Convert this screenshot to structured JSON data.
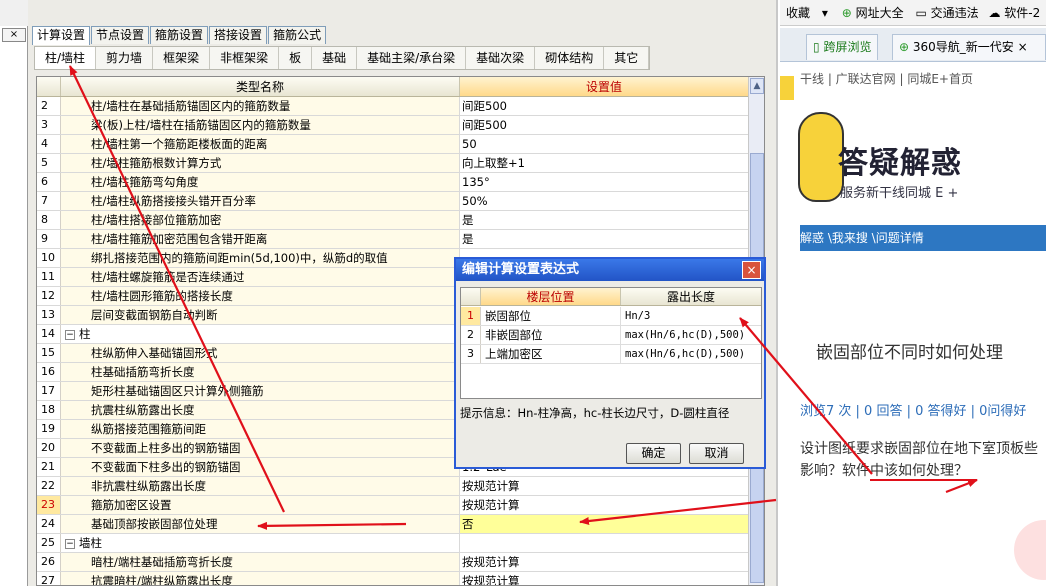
{
  "left_strip": {
    "close_glyph": "×"
  },
  "top_tabs": [
    {
      "label": "计算设置",
      "active": true
    },
    {
      "label": "节点设置"
    },
    {
      "label": "箍筋设置"
    },
    {
      "label": "搭接设置"
    },
    {
      "label": "箍筋公式"
    }
  ],
  "sub_tabs": [
    {
      "label": "柱/墙柱",
      "active": true
    },
    {
      "label": "剪力墙"
    },
    {
      "label": "框架梁"
    },
    {
      "label": "非框架梁"
    },
    {
      "label": "板"
    },
    {
      "label": "基础"
    },
    {
      "label": "基础主梁/承台梁"
    },
    {
      "label": "基础次梁"
    },
    {
      "label": "砌体结构"
    },
    {
      "label": "其它"
    }
  ],
  "grid": {
    "header_name": "类型名称",
    "header_value": "设置值",
    "rows": [
      {
        "n": "2",
        "name": "柱/墙柱在基础插筋锚固区内的箍筋数量",
        "val": "间距500"
      },
      {
        "n": "3",
        "name": "梁(板)上柱/墙柱在插筋锚固区内的箍筋数量",
        "val": "间距500"
      },
      {
        "n": "4",
        "name": "柱/墙柱第一个箍筋距楼板面的距离",
        "val": "50"
      },
      {
        "n": "5",
        "name": "柱/墙柱箍筋根数计算方式",
        "val": "向上取整+1"
      },
      {
        "n": "6",
        "name": "柱/墙柱箍筋弯勾角度",
        "val": "135°"
      },
      {
        "n": "7",
        "name": "柱/墙柱纵筋搭接接头错开百分率",
        "val": "50%"
      },
      {
        "n": "8",
        "name": "柱/墙柱搭接部位箍筋加密",
        "val": "是"
      },
      {
        "n": "9",
        "name": "柱/墙柱箍筋加密范围包含错开距离",
        "val": "是"
      },
      {
        "n": "10",
        "name": "绑扎搭接范围内的箍筋间距min(5d,100)中，纵筋d的取值",
        "val": ""
      },
      {
        "n": "11",
        "name": "柱/墙柱螺旋箍筋是否连续通过",
        "val": ""
      },
      {
        "n": "12",
        "name": "柱/墙柱圆形箍筋的搭接长度",
        "val": ""
      },
      {
        "n": "13",
        "name": "层间变截面钢筋自动判断",
        "val": ""
      },
      {
        "n": "14",
        "name": "柱",
        "val": "",
        "group": true
      },
      {
        "n": "15",
        "name": "柱纵筋伸入基础锚固形式",
        "val": ""
      },
      {
        "n": "16",
        "name": "柱基础插筋弯折长度",
        "val": ""
      },
      {
        "n": "17",
        "name": "矩形柱基础锚固区只计算外侧箍筋",
        "val": ""
      },
      {
        "n": "18",
        "name": "抗震柱纵筋露出长度",
        "val": ""
      },
      {
        "n": "19",
        "name": "纵筋搭接范围箍筋间距",
        "val": ""
      },
      {
        "n": "20",
        "name": "不变截面上柱多出的钢筋锚固",
        "val": ""
      },
      {
        "n": "21",
        "name": "不变截面下柱多出的钢筋锚固",
        "val": "1.2*Lae"
      },
      {
        "n": "22",
        "name": "非抗震柱纵筋露出长度",
        "val": "按规范计算"
      },
      {
        "n": "23",
        "name": "箍筋加密区设置",
        "val": "按规范计算",
        "sel": true
      },
      {
        "n": "24",
        "name": "基础顶部按嵌固部位处理",
        "val": "否",
        "hl": true
      },
      {
        "n": "25",
        "name": "墙柱",
        "val": "",
        "group": true
      },
      {
        "n": "26",
        "name": "暗柱/端柱基础插筋弯折长度",
        "val": "按规范计算"
      },
      {
        "n": "27",
        "name": "抗震暗柱/端柱纵筋露出长度",
        "val": "按规范计算"
      }
    ]
  },
  "dialog": {
    "title": "编辑计算设置表达式",
    "close_glyph": "×",
    "col1": "楼层位置",
    "col2": "露出长度",
    "rows": [
      {
        "n": "1",
        "pos": "嵌固部位",
        "len": "Hn/3",
        "sel": true
      },
      {
        "n": "2",
        "pos": "非嵌固部位",
        "len": "max(Hn/6,hc(D),500)"
      },
      {
        "n": "3",
        "pos": "上端加密区",
        "len": "max(Hn/6,hc(D),500)"
      }
    ],
    "hint": "提示信息：Hn-柱净高，hc-柱长边尺寸，D-圆柱直径",
    "ok_label": "确定",
    "cancel_label": "取消"
  },
  "browser": {
    "toolbar_items": [
      "收藏",
      "网址大全",
      "交通违法",
      "软件-2"
    ],
    "tabs": [
      "跨屏浏览",
      "360导航_新一代安"
    ],
    "nav_links": "干线 | 广联达官网 | 同城E+首页",
    "hero_title": "答疑解惑",
    "hero_sub": "服务新干线同城 E +",
    "breadcrumb": "解惑 \\我来搜 \\问题详情",
    "question_title": "嵌固部位不同时如何处理",
    "stats": "浏览7 次 | 0 回答 | 0 答得好 | 0问得好",
    "desc": "设计图纸要求嵌固部位在地下室顶板些影响？软件中该如何处理？"
  },
  "colors": {
    "arrow": "#e0101a",
    "dialog_blue": "#2a5bd7",
    "highlight": "#ffff99"
  }
}
